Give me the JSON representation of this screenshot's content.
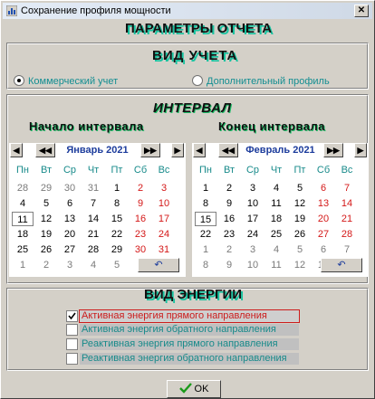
{
  "window": {
    "title": "Сохранение профиля мощности"
  },
  "report_header": "ПАРАМЕТРЫ ОТЧЕТА",
  "accounting": {
    "header": "ВИД   УЧЕТА",
    "options": [
      {
        "label": "Коммерческий учет",
        "selected": true
      },
      {
        "label": "Дополнительный профиль",
        "selected": false
      }
    ]
  },
  "interval": {
    "header": "ИНТЕРВАЛ",
    "start_label": "Начало   интервала",
    "end_label": "Конец   интервала"
  },
  "weekdays": [
    "Пн",
    "Вт",
    "Ср",
    "Чт",
    "Пт",
    "Сб",
    "Вс"
  ],
  "calendars": [
    {
      "month": "Январь 2021",
      "undo_icon": "undo-icon",
      "weeks": [
        [
          "28",
          "29",
          "30",
          "31",
          "1",
          "2",
          "3"
        ],
        [
          "4",
          "5",
          "6",
          "7",
          "8",
          "9",
          "10"
        ],
        [
          "11",
          "12",
          "13",
          "14",
          "15",
          "16",
          "17"
        ],
        [
          "18",
          "19",
          "20",
          "21",
          "22",
          "23",
          "24"
        ],
        [
          "25",
          "26",
          "27",
          "28",
          "29",
          "30",
          "31"
        ],
        [
          "1",
          "2",
          "3",
          "4",
          "5",
          "6",
          "7"
        ]
      ],
      "selected": "11"
    },
    {
      "month": "Февраль 2021",
      "undo_icon": "undo-icon",
      "weeks": [
        [
          "1",
          "2",
          "3",
          "4",
          "5",
          "6",
          "7"
        ],
        [
          "8",
          "9",
          "10",
          "11",
          "12",
          "13",
          "14"
        ],
        [
          "15",
          "16",
          "17",
          "18",
          "19",
          "20",
          "21"
        ],
        [
          "22",
          "23",
          "24",
          "25",
          "26",
          "27",
          "28"
        ],
        [
          "1",
          "2",
          "3",
          "4",
          "5",
          "6",
          "7"
        ],
        [
          "8",
          "9",
          "10",
          "11",
          "12",
          "13",
          "14"
        ]
      ],
      "selected": "15"
    }
  ],
  "energy": {
    "header": "ВИД ЭНЕРГИИ",
    "items": [
      {
        "label": "Активная энергия прямого направления",
        "checked": true
      },
      {
        "label": "Активная энергия обратного направления",
        "checked": false
      },
      {
        "label": "Реактивная энергия прямого направления",
        "checked": false
      },
      {
        "label": "Реактивная энергия обратного направления",
        "checked": false
      }
    ]
  },
  "ok_button": {
    "label": "OK",
    "icon": "checkmark-icon"
  },
  "colors": {
    "accent_shadow": "#17c3a0",
    "weekend": "#d41818",
    "month": "#1c3c9c",
    "teal_text": "#178a8a"
  }
}
